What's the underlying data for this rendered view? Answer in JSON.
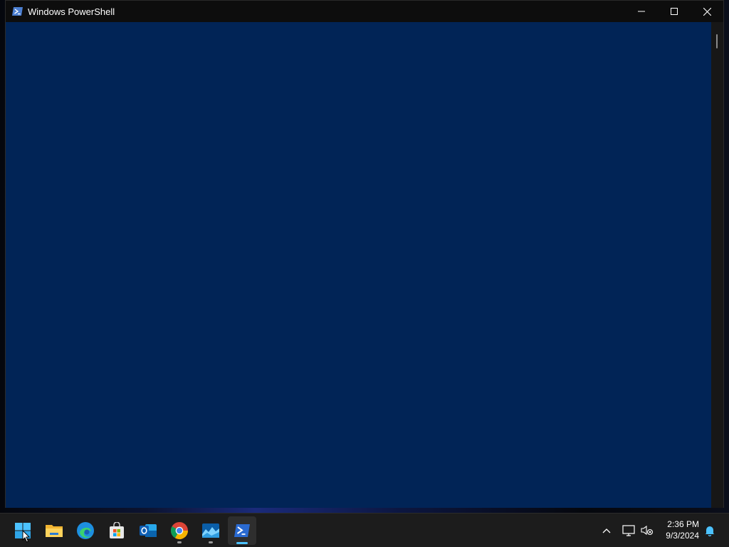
{
  "window": {
    "title": "Windows PowerShell",
    "console_background": "#012456"
  },
  "caption_buttons": [
    "minimize",
    "maximize",
    "close"
  ],
  "taskbar": {
    "apps": [
      {
        "name": "Start",
        "icon": "windows-start-icon"
      },
      {
        "name": "File Explorer",
        "icon": "file-explorer-icon"
      },
      {
        "name": "Microsoft Edge",
        "icon": "edge-icon"
      },
      {
        "name": "Microsoft Store",
        "icon": "store-icon"
      },
      {
        "name": "Outlook",
        "icon": "outlook-icon"
      },
      {
        "name": "Google Chrome",
        "icon": "chrome-icon",
        "running": true
      },
      {
        "name": "Photos",
        "icon": "photos-icon",
        "running": true
      },
      {
        "name": "Windows PowerShell",
        "icon": "powershell-icon",
        "active": true
      }
    ],
    "tray": {
      "icons": [
        "chevron-up-icon",
        "network-icon",
        "volume-muted-icon",
        "notification-bell-icon"
      ],
      "time": "2:36 PM",
      "date": "9/3/2024"
    }
  }
}
